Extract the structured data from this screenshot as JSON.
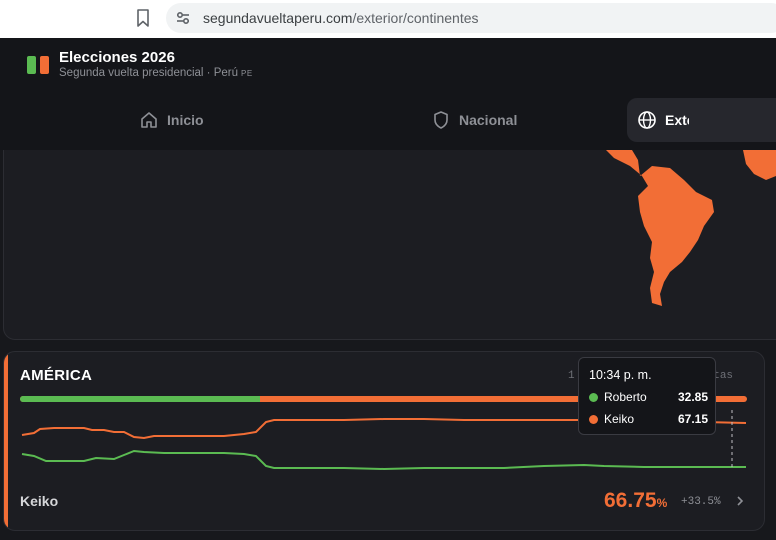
{
  "browser": {
    "url_domain": "segundavueltaperu.com",
    "url_path": "/exterior/continentes"
  },
  "header": {
    "title": "Elecciones 2026",
    "subtitle": "Segunda vuelta presidencial · Perú",
    "flag": "PE"
  },
  "nav": {
    "tabs": [
      {
        "label": "Inicio",
        "icon": "home-icon"
      },
      {
        "label": "Nacional",
        "icon": "shield-icon"
      },
      {
        "label": "Exterior",
        "icon": "globe-icon",
        "active": true
      }
    ]
  },
  "colors": {
    "roberto": "#5bbb52",
    "keiko": "#f26e36",
    "background": "#17181c",
    "card": "#1c1d22"
  },
  "continent": {
    "name": "AMÉRICA",
    "actas_prefix": "1",
    "actas_suffix": "actas",
    "bar_roberto_fraction": 0.33,
    "leader_name": "Keiko",
    "leader_pct": "66.75",
    "leader_pct_unit": "%",
    "leader_delta": "+33.5%"
  },
  "tooltip": {
    "time": "10:34 p. m.",
    "rows": [
      {
        "name": "Roberto",
        "value": "32.85",
        "color": "#5bbb52"
      },
      {
        "name": "Keiko",
        "value": "67.15",
        "color": "#f26e36"
      }
    ]
  }
}
